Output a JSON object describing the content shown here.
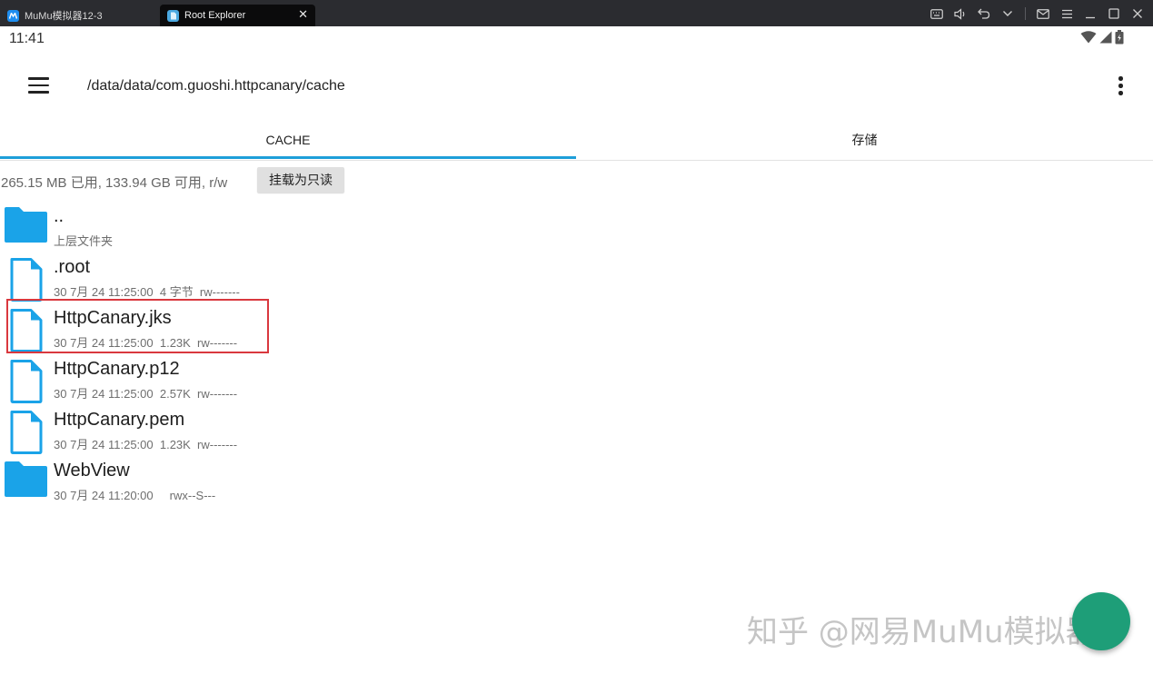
{
  "emulator": {
    "tabs": [
      {
        "label": "MuMu模拟器12-3"
      },
      {
        "label": "Root Explorer"
      }
    ],
    "close_glyph": "✕",
    "controls": [
      "keyboard-icon",
      "volume-icon",
      "back-icon",
      "chevron-down-icon",
      "mail-icon",
      "menu-icon",
      "minimize-icon",
      "maximize-icon",
      "close-icon"
    ]
  },
  "statusbar": {
    "time": "11:41",
    "icons": [
      "wifi-icon",
      "signal-icon",
      "battery-icon"
    ]
  },
  "toolbar": {
    "path": "/data/data/com.guoshi.httpcanary/cache"
  },
  "tabs": [
    {
      "label": "CACHE",
      "active": true
    },
    {
      "label": "存储",
      "active": false
    }
  ],
  "storage": {
    "info": "265.15 MB 已用, 133.94 GB 可用, r/w",
    "mount_button": "挂载为只读"
  },
  "files": [
    {
      "name": "..",
      "meta": "上层文件夹",
      "type": "folder"
    },
    {
      "name": ".root",
      "meta": "30 7月 24 11:25:00  4 字节  rw-------",
      "type": "file"
    },
    {
      "name": "HttpCanary.jks",
      "meta": "30 7月 24 11:25:00  1.23K  rw-------",
      "type": "file",
      "highlighted": true
    },
    {
      "name": "HttpCanary.p12",
      "meta": "30 7月 24 11:25:00  2.57K  rw-------",
      "type": "file"
    },
    {
      "name": "HttpCanary.pem",
      "meta": "30 7月 24 11:25:00  1.23K  rw-------",
      "type": "file"
    },
    {
      "name": "WebView",
      "meta": "30 7月 24 11:20:00     rwx--S---",
      "type": "folder"
    }
  ],
  "watermark": "知乎 @网易MuMu模拟器",
  "colors": {
    "accent": "#1e9fd9",
    "folder": "#1aa3e8",
    "file_outline": "#1aa3e8",
    "highlight": "#d9383e",
    "fab": "#1e9e78"
  }
}
